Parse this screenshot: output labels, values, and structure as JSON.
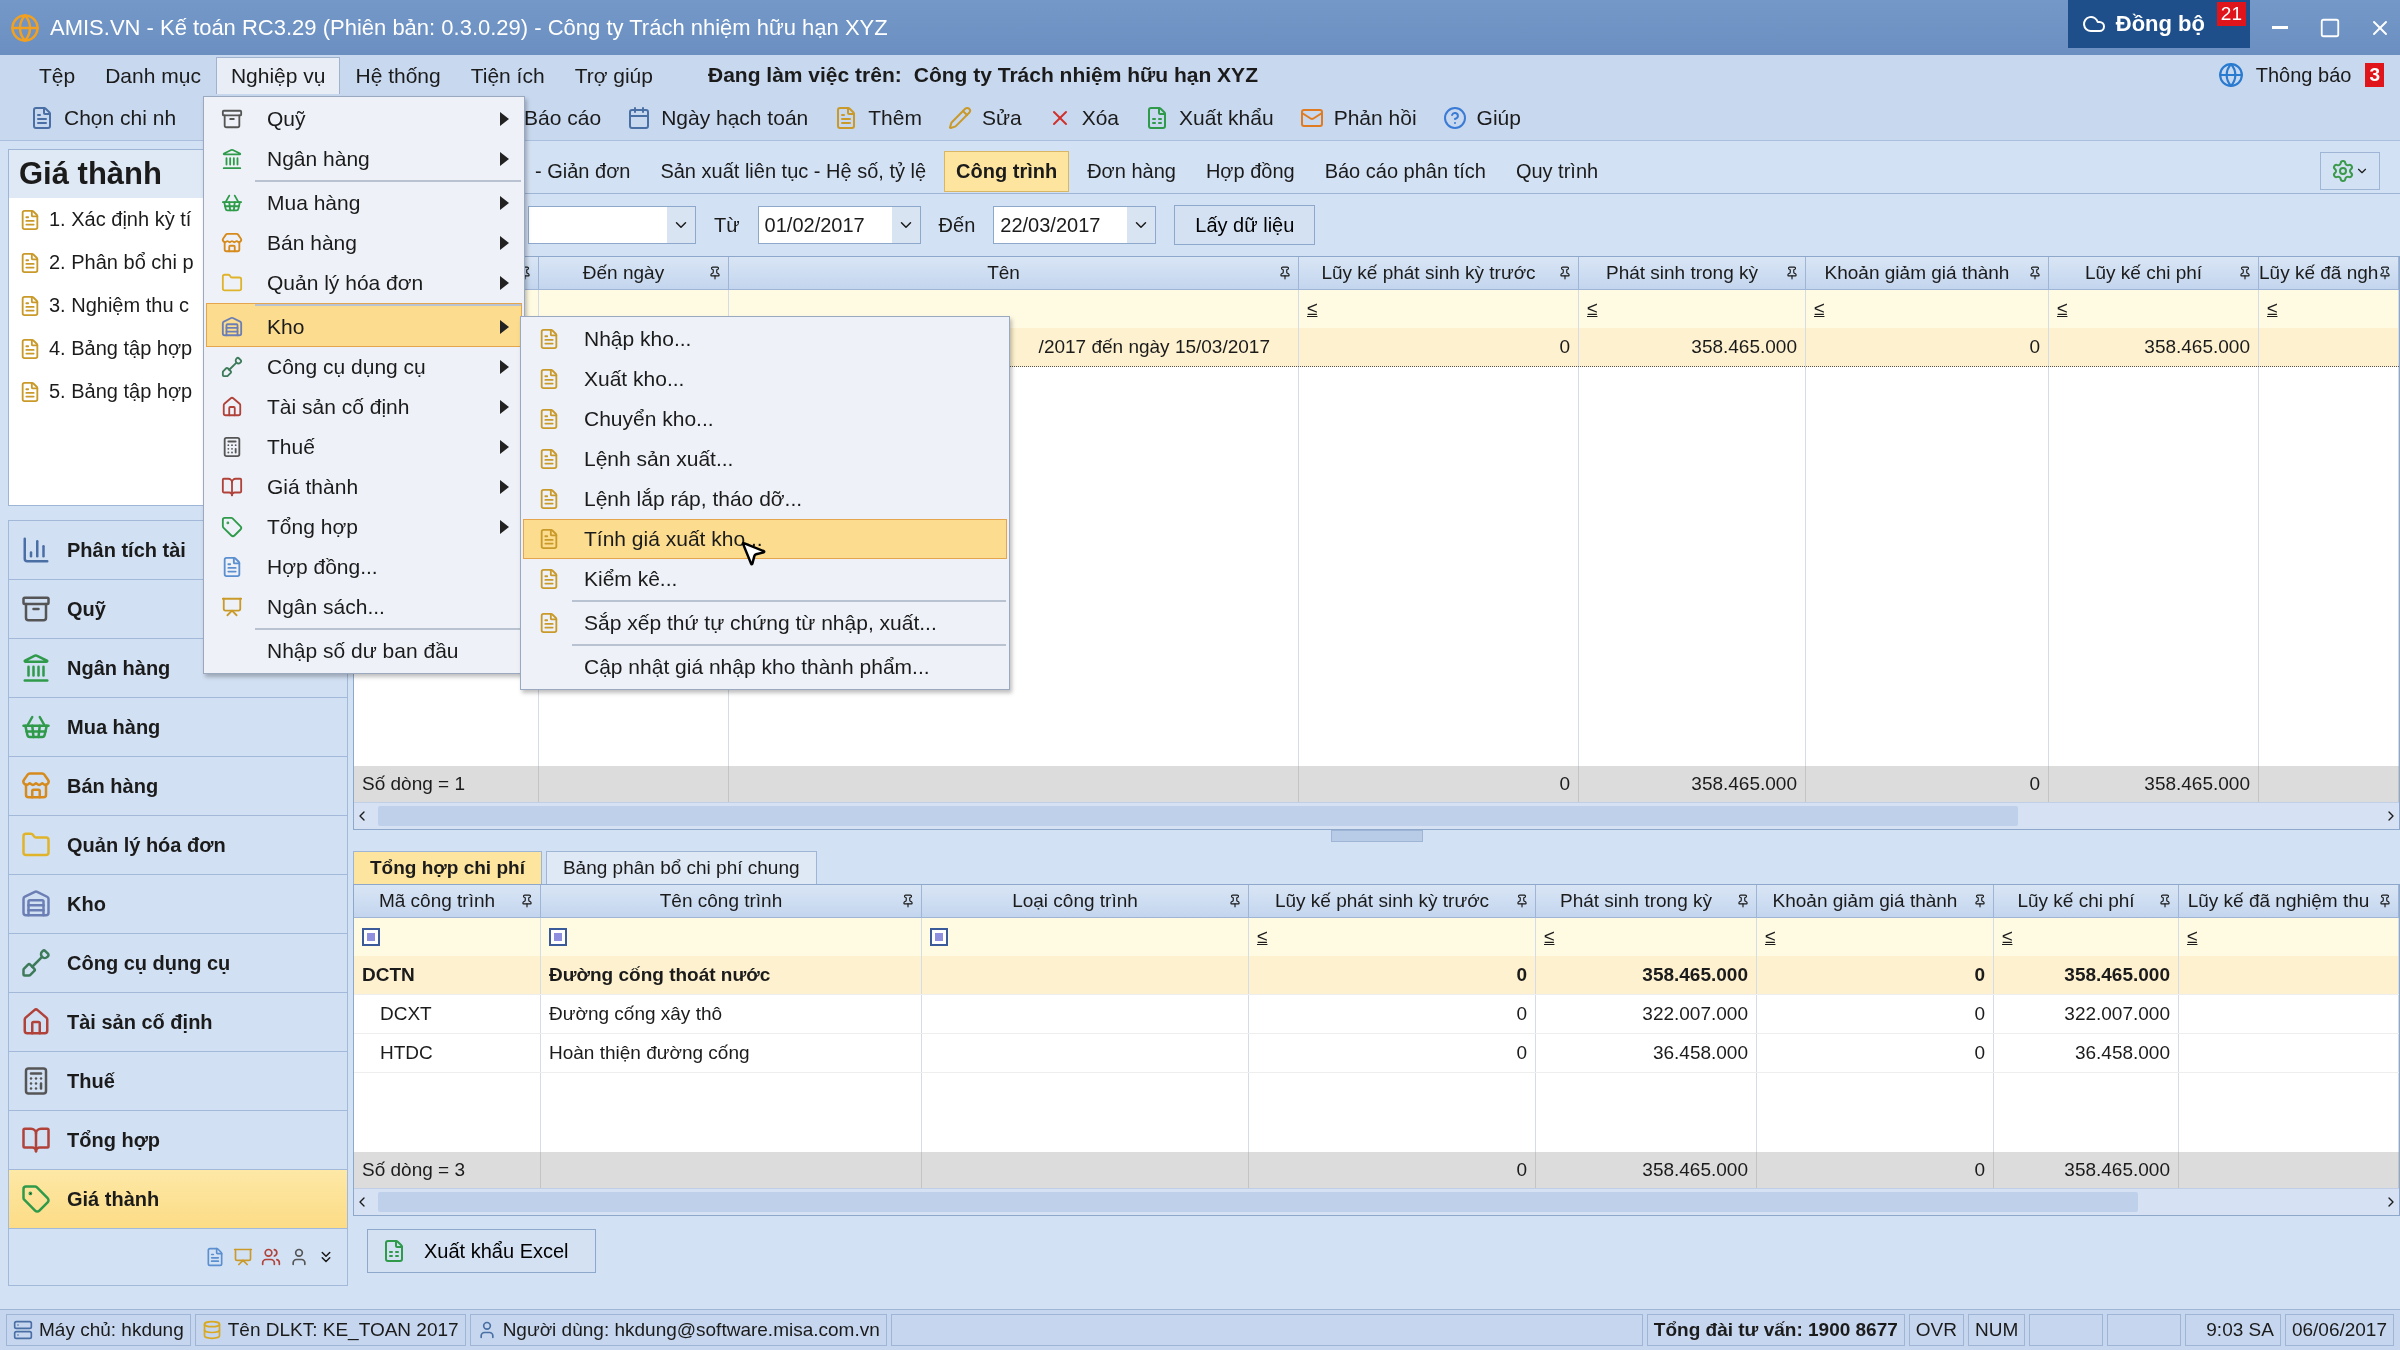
{
  "title_bar": {
    "title": "AMIS.VN - Kế toán RC3.29 (Phiên bản: 0.3.0.29) - Công ty Trách nhiệm hữu hạn XYZ",
    "sync_button": "Đồng bộ",
    "sync_badge": "21"
  },
  "menu_bar": {
    "items": [
      {
        "label": "Tệp",
        "selected": false
      },
      {
        "label": "Danh mục",
        "selected": false
      },
      {
        "label": "Nghiệp vụ",
        "selected": true
      },
      {
        "label": "Hệ thống",
        "selected": false
      },
      {
        "label": "Tiện ích",
        "selected": false
      },
      {
        "label": "Trợ giúp",
        "selected": false
      }
    ],
    "working_label": "Đang làm việc trên:",
    "company": "Công ty Trách nhiệm hữu hạn XYZ",
    "notification": "Thông báo",
    "notification_badge": "3"
  },
  "toolbar": [
    "Chọn chi nh",
    "Báo cáo",
    "Ngày hạch toán",
    "Thêm",
    "Sửa",
    "Xóa",
    "Xuất khẩu",
    "Phản hồi",
    "Giúp"
  ],
  "left_panel": {
    "title": "Giá thành",
    "tasks": [
      "1. Xác định kỳ tí",
      "2. Phân bổ chi p",
      "3. Nghiệm thu c",
      "4. Bảng tập hợp",
      "5. Bảng tập hợp"
    ],
    "nav": [
      {
        "label": "Phân tích tài",
        "selected": false
      },
      {
        "label": "Quỹ",
        "selected": false
      },
      {
        "label": "Ngân hàng",
        "selected": false
      },
      {
        "label": "Mua hàng",
        "selected": false
      },
      {
        "label": "Bán hàng",
        "selected": false
      },
      {
        "label": "Quản lý hóa đơn",
        "selected": false
      },
      {
        "label": "Kho",
        "selected": false
      },
      {
        "label": "Công cụ dụng cụ",
        "selected": false
      },
      {
        "label": "Tài sản cố định",
        "selected": false
      },
      {
        "label": "Thuế",
        "selected": false
      },
      {
        "label": "Tổng hợp",
        "selected": false
      },
      {
        "label": "Giá thành",
        "selected": true
      }
    ]
  },
  "tabs": [
    {
      "label": "- Giản đơn",
      "selected": false
    },
    {
      "label": "Sản xuất liên tục - Hệ số, tỷ lệ",
      "selected": false
    },
    {
      "label": "Công trình",
      "selected": true
    },
    {
      "label": "Đơn hàng",
      "selected": false
    },
    {
      "label": "Hợp đồng",
      "selected": false
    },
    {
      "label": "Báo cáo phân tích",
      "selected": false
    },
    {
      "label": "Quy trình",
      "selected": false
    }
  ],
  "filter": {
    "from_label": "Từ",
    "from": "01/02/2017",
    "to_label": "Đến",
    "to": "22/03/2017",
    "button": "Lấy dữ liệu"
  },
  "upper_grid": {
    "columns": [
      {
        "label": "Đến ngày"
      },
      {
        "label": "Tên"
      },
      {
        "label": "Lũy kế phát sinh kỳ trước",
        "filter": {
          "kind": "op",
          "text": "≤"
        }
      },
      {
        "label": "Phát sinh trong kỳ",
        "filter": {
          "kind": "op",
          "text": "≤"
        }
      },
      {
        "label": "Khoản giảm giá thành",
        "filter": {
          "kind": "op",
          "text": "≤"
        }
      },
      {
        "label": "Lũy kế chi phí",
        "filter": {
          "kind": "op",
          "text": "≤"
        }
      },
      {
        "label": "Lũy kế đã ngh",
        "filter": {
          "kind": "op",
          "text": "≤"
        }
      }
    ],
    "rows": [
      {
        "selected": true,
        "cells": [
          null,
          "/2017 đến ngày 15/03/2017",
          "0",
          "358.465.000",
          "0",
          "358.465.000"
        ]
      }
    ],
    "footer": {
      "count": "Số dòng = 1",
      "cells": [
        null,
        null,
        "0",
        "358.465.000",
        "0",
        "358.465.000"
      ]
    }
  },
  "lower_tabs": [
    {
      "label": "Tổng hợp chi phí",
      "selected": true
    },
    {
      "label": "Bảng phân bổ chi phí chung",
      "selected": false
    }
  ],
  "lower_grid": {
    "columns": [
      {
        "label": "Mã công trình",
        "filter": {
          "kind": "condition"
        }
      },
      {
        "label": "Tên công trình",
        "filter": {
          "kind": "condition"
        }
      },
      {
        "label": "Loại công trình",
        "filter": {
          "kind": "condition"
        }
      },
      {
        "label": "Lũy kế phát sinh kỳ trước",
        "filter": {
          "kind": "op",
          "text": "≤"
        }
      },
      {
        "label": "Phát sinh trong kỳ",
        "filter": {
          "kind": "op",
          "text": "≤"
        }
      },
      {
        "label": "Khoản giảm giá thành",
        "filter": {
          "kind": "op",
          "text": "≤"
        }
      },
      {
        "label": "Lũy kế chi phí",
        "filter": {
          "kind": "op",
          "text": "≤"
        }
      },
      {
        "label": "Lũy kế đã nghiệm thu",
        "filter": {
          "kind": "op",
          "text": "≤"
        }
      }
    ],
    "rows": [
      {
        "selected": true,
        "cells": [
          "DCTN",
          "Đường cống thoát nước",
          null,
          "0",
          "358.465.000",
          "0",
          "358.465.000"
        ],
        "children": [
          {
            "selected": false,
            "cells": [
              "DCXT",
              "Đường cống xây thô",
              null,
              "0",
              "322.007.000",
              "0",
              "322.007.000"
            ]
          },
          {
            "selected": false,
            "cells": [
              "HTDC",
              "Hoàn thiện đường cống",
              null,
              "0",
              "36.458.000",
              "0",
              "36.458.000"
            ]
          }
        ]
      }
    ],
    "footer": {
      "count": "Số dòng = 3",
      "cells": [
        null,
        null,
        "0",
        "358.465.000",
        "0",
        "358.465.000"
      ]
    }
  },
  "export_button": "Xuất khẩu Excel",
  "menu": {
    "items": [
      {
        "label": "Quỹ",
        "has_submenu": true,
        "selected": false,
        "separator_before": false
      },
      {
        "label": "Ngân hàng",
        "has_submenu": true,
        "selected": false,
        "separator_before": false
      },
      {
        "label": "Mua hàng",
        "has_submenu": true,
        "selected": false,
        "separator_before": true
      },
      {
        "label": "Bán hàng",
        "has_submenu": true,
        "selected": false,
        "separator_before": false
      },
      {
        "label": "Quản lý hóa đơn",
        "has_submenu": true,
        "selected": false,
        "separator_before": false
      },
      {
        "label": "Kho",
        "has_submenu": true,
        "selected": true,
        "separator_before": true
      },
      {
        "label": "Công cụ dụng cụ",
        "has_submenu": true,
        "selected": false,
        "separator_before": false
      },
      {
        "label": "Tài sản cố định",
        "has_submenu": true,
        "selected": false,
        "separator_before": false
      },
      {
        "label": "Thuế",
        "has_submenu": true,
        "selected": false,
        "separator_before": false
      },
      {
        "label": "Giá thành",
        "has_submenu": true,
        "selected": false,
        "separator_before": false
      },
      {
        "label": "Tổng hợp",
        "has_submenu": true,
        "selected": false,
        "separator_before": false
      },
      {
        "label": "Hợp đồng...",
        "has_submenu": false,
        "selected": false,
        "separator_before": false
      },
      {
        "label": "Ngân sách...",
        "has_submenu": false,
        "selected": false,
        "separator_before": false
      },
      {
        "label": "Nhập số dư ban đầu",
        "has_submenu": false,
        "selected": false,
        "separator_before": true
      }
    ]
  },
  "submenu": {
    "items": [
      {
        "label": "Nhập kho...",
        "selected": false,
        "separator_before": false
      },
      {
        "label": "Xuất kho...",
        "selected": false,
        "separator_before": false
      },
      {
        "label": "Chuyển kho...",
        "selected": false,
        "separator_before": false
      },
      {
        "label": "Lệnh sản xuất...",
        "selected": false,
        "separator_before": false
      },
      {
        "label": "Lệnh lắp ráp, tháo dỡ...",
        "selected": false,
        "separator_before": false
      },
      {
        "label": "Tính giá xuất kho...",
        "selected": true,
        "separator_before": false
      },
      {
        "label": "Kiểm kê...",
        "selected": false,
        "separator_before": false
      },
      {
        "label": "Sắp xếp thứ tự chứng từ nhập, xuất...",
        "selected": false,
        "separator_before": true
      },
      {
        "label": "Cập nhật giá nhập kho thành phẩm...",
        "selected": false,
        "separator_before": true
      }
    ]
  },
  "status_bar": {
    "server": "Máy chủ: hkdung",
    "database": "Tên DLKT: KE_TOAN 2017",
    "user": "Người dùng: hkdung@software.misa.com.vn",
    "hotline": "Tổng đài tư vấn: 1900 8677",
    "ovr": "OVR",
    "num": "NUM",
    "time": "9:03 SA",
    "date": "06/06/2017"
  }
}
